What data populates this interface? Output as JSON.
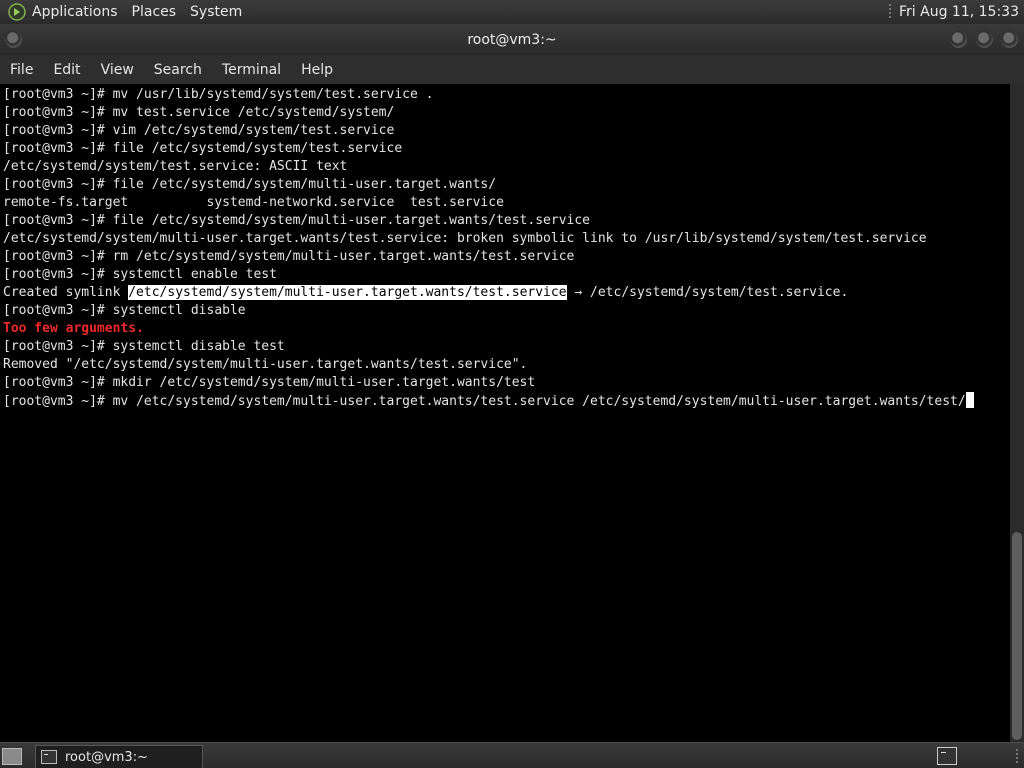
{
  "top_panel": {
    "menus": [
      "Applications",
      "Places",
      "System"
    ],
    "clock": "Fri Aug 11, 15:33"
  },
  "window": {
    "title": "root@vm3:~"
  },
  "menubar": {
    "items": [
      "File",
      "Edit",
      "View",
      "Search",
      "Terminal",
      "Help"
    ]
  },
  "terminal": {
    "lines": [
      "[root@vm3 ~]# mv /usr/lib/systemd/system/test.service .",
      "[root@vm3 ~]# mv test.service /etc/systemd/system/",
      "[root@vm3 ~]# vim /etc/systemd/system/test.service",
      "[root@vm3 ~]# file /etc/systemd/system/test.service",
      "/etc/systemd/system/test.service: ASCII text",
      "[root@vm3 ~]# file /etc/systemd/system/multi-user.target.wants/",
      "remote-fs.target          systemd-networkd.service  test.service",
      "[root@vm3 ~]# file /etc/systemd/system/multi-user.target.wants/test.service",
      "/etc/systemd/system/multi-user.target.wants/test.service: broken symbolic link to /usr/lib/systemd/system/test.service",
      "[root@vm3 ~]# rm /etc/systemd/system/multi-user.target.wants/test.service",
      "[root@vm3 ~]# systemctl enable test"
    ],
    "symlink_line": {
      "prefix": "Created symlink ",
      "selected": "/etc/systemd/system/multi-user.target.wants/test.service",
      "suffix": " → /etc/systemd/system/test.service."
    },
    "line_after_symlink": "[root@vm3 ~]# systemctl disable",
    "error_line": "Too few arguments.",
    "lines_after_error": [
      "[root@vm3 ~]# systemctl disable test",
      "Removed \"/etc/systemd/system/multi-user.target.wants/test.service\".",
      "[root@vm3 ~]# mkdir /etc/systemd/system/multi-user.target.wants/test"
    ],
    "current_input": "[root@vm3 ~]# mv /etc/systemd/system/multi-user.target.wants/test.service /etc/systemd/system/multi-user.target.wants/test/",
    "error_color": "#ef2929",
    "text_color": "#e4e4e4"
  },
  "taskbar": {
    "task_label": "root@vm3:~"
  }
}
